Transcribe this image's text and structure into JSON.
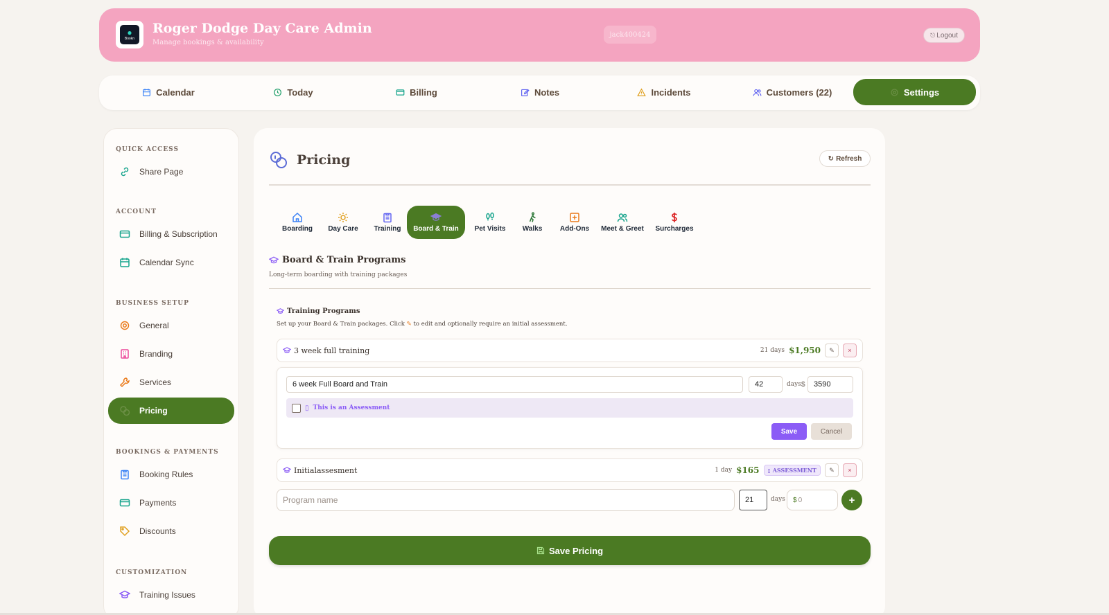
{
  "header": {
    "title": "Roger Dodge Day Care Admin",
    "subtitle": "Manage bookings & availability",
    "logo_text": "Bookn",
    "username": "jack400424",
    "logout_label": "Logout"
  },
  "nav": {
    "items": [
      {
        "label": "Calendar",
        "icon": "calendar-icon"
      },
      {
        "label": "Today",
        "icon": "clock-icon"
      },
      {
        "label": "Billing",
        "icon": "credit-card-icon"
      },
      {
        "label": "Notes",
        "icon": "edit-icon"
      },
      {
        "label": "Incidents",
        "icon": "warning-icon"
      },
      {
        "label": "Customers (22)",
        "icon": "users-icon"
      },
      {
        "label": "Settings",
        "icon": "gear-icon"
      }
    ],
    "active": "Settings"
  },
  "sidebar": {
    "sections": {
      "quick_access": "QUICK ACCESS",
      "account": "ACCOUNT",
      "business_setup": "BUSINESS SETUP",
      "bookings_payments": "BOOKINGS & PAYMENTS",
      "customization": "CUSTOMIZATION"
    },
    "items": {
      "share_page": "Share Page",
      "billing_subscription": "Billing & Subscription",
      "calendar_sync": "Calendar Sync",
      "general": "General",
      "branding": "Branding",
      "services": "Services",
      "pricing": "Pricing",
      "booking_rules": "Booking Rules",
      "payments": "Payments",
      "discounts": "Discounts",
      "training_issues": "Training Issues"
    },
    "active": "Pricing"
  },
  "main": {
    "title": "Pricing",
    "refresh_label": "Refresh",
    "tabs": [
      {
        "label": "Boarding",
        "icon": "house-icon"
      },
      {
        "label": "Day Care",
        "icon": "sun-icon"
      },
      {
        "label": "Training",
        "icon": "clipboard-icon"
      },
      {
        "label": "Board & Train",
        "icon": "graduation-cap-icon"
      },
      {
        "label": "Pet Visits",
        "icon": "footprints-icon"
      },
      {
        "label": "Walks",
        "icon": "walking-icon"
      },
      {
        "label": "Add-Ons",
        "icon": "plus-square-icon"
      },
      {
        "label": "Meet & Greet",
        "icon": "users-icon"
      },
      {
        "label": "Surcharges",
        "icon": "dollar-icon"
      }
    ],
    "active_tab": "Board & Train",
    "section_title": "Board & Train Programs",
    "section_desc": "Long-term boarding with training packages",
    "programs_title": "Training Programs",
    "programs_desc_pre": "Set up your Board & Train packages. Click",
    "programs_desc_post": "to edit and optionally require an initial assessment.",
    "programs": [
      {
        "name": "3 week full training",
        "days": "21 days",
        "price": "$1,950"
      },
      {
        "name": "Initialassesment",
        "days": "1 day",
        "price": "$165",
        "badge": "ASSESSMENT"
      }
    ],
    "edit": {
      "name_value": "6 week Full Board and Train",
      "days_value": "42",
      "days_label": "days",
      "currency": "$",
      "price_value": "3590",
      "assessment_label": "This is an Assessment",
      "save_label": "Save",
      "cancel_label": "Cancel"
    },
    "new_program": {
      "name_placeholder": "Program name",
      "days_value": "21",
      "days_label": "days",
      "currency": "$",
      "price_placeholder": "0",
      "add_label": "+"
    },
    "save_pricing_label": "Save Pricing"
  },
  "colors": {
    "accent_green": "#4b7a23",
    "header_pink": "#f4a4c0",
    "purple": "#8b5cf6"
  }
}
